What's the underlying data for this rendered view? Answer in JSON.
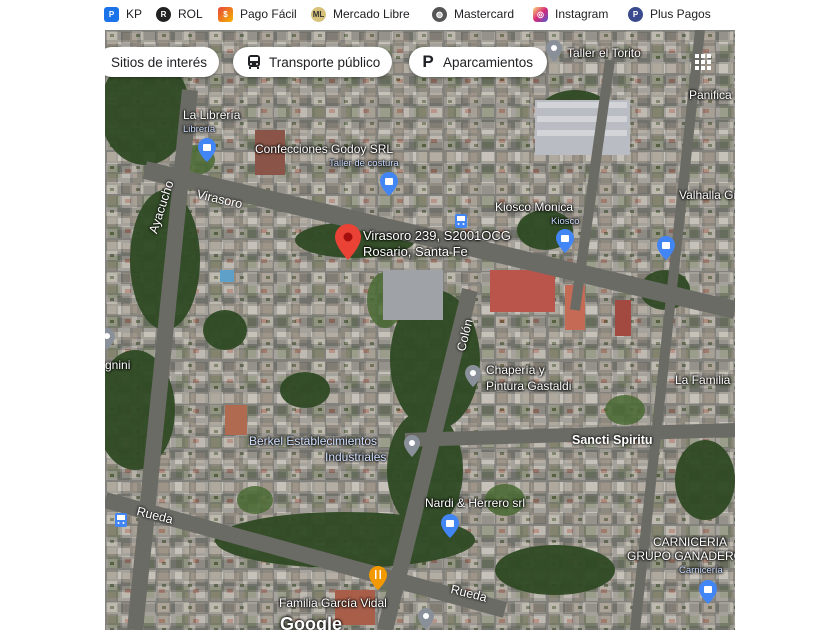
{
  "bookmarks": [
    {
      "label": "KP",
      "icon": "kp-icon",
      "color": "#1a73e8"
    },
    {
      "label": "ROL",
      "icon": "rol-icon",
      "color": "#222222"
    },
    {
      "label": "Pago Fácil",
      "icon": "pago-facil-icon",
      "color": "#e8453c"
    },
    {
      "label": "Mercado Libre",
      "icon": "mercado-libre-icon",
      "color": "#d6c27a"
    },
    {
      "label": "Mastercard",
      "icon": "globe-icon",
      "color": "#555555"
    },
    {
      "label": "Instagram",
      "icon": "instagram-icon",
      "color": "#d6249f"
    },
    {
      "label": "Plus Pagos",
      "icon": "plus-pagos-icon",
      "color": "#3a4a8c"
    }
  ],
  "chips": [
    {
      "label": "Sitios de interés",
      "icon": ""
    },
    {
      "label": "Transporte público",
      "icon": "bus-icon"
    },
    {
      "label": "Aparcamientos",
      "icon": "parking-icon"
    }
  ],
  "address": {
    "line1": "Virasoro 239, S2001OCG",
    "line2": "Rosario, Santa Fe"
  },
  "places": {
    "taller_torito": "Taller el Torito",
    "panifica": "Panifica",
    "la_libreria": "La Librería",
    "libreria": "Librería",
    "confecciones": "Confecciones Godoy SRL",
    "taller_costura": "Taller de costura",
    "kiosco_monica": "Kiosco Monica",
    "kiosco": "Kiosco",
    "valhalla": "Valhalla Gi",
    "gnini": "gnini",
    "chaperia_1": "Chapería y",
    "chaperia_2": "Pintura Gastaldi",
    "la_familia": "La Familia",
    "berkel_1": "Berkel Establecimientos",
    "berkel_2": "Industriales",
    "nardi": "Nardi & Herrero srl",
    "carniceria_1": "CARNICERIA",
    "carniceria_2": "GRUPO GANADERO",
    "carniceria": "Carnicería",
    "familia_garcia": "Familia García Vidal"
  },
  "streets": {
    "ayacucho": "Ayacucho",
    "virasoro": "Virasoro",
    "colon": "Colón",
    "sancti_spiritu": "Sancti Spiritu",
    "rueda_1": "Rueda",
    "rueda_2": "Rueda"
  },
  "logo": "Google",
  "colors": {
    "pin_red": "#ea4335",
    "pin_blue": "#4285f4",
    "pin_gray": "#8a9099",
    "pin_orange": "#f29900"
  }
}
